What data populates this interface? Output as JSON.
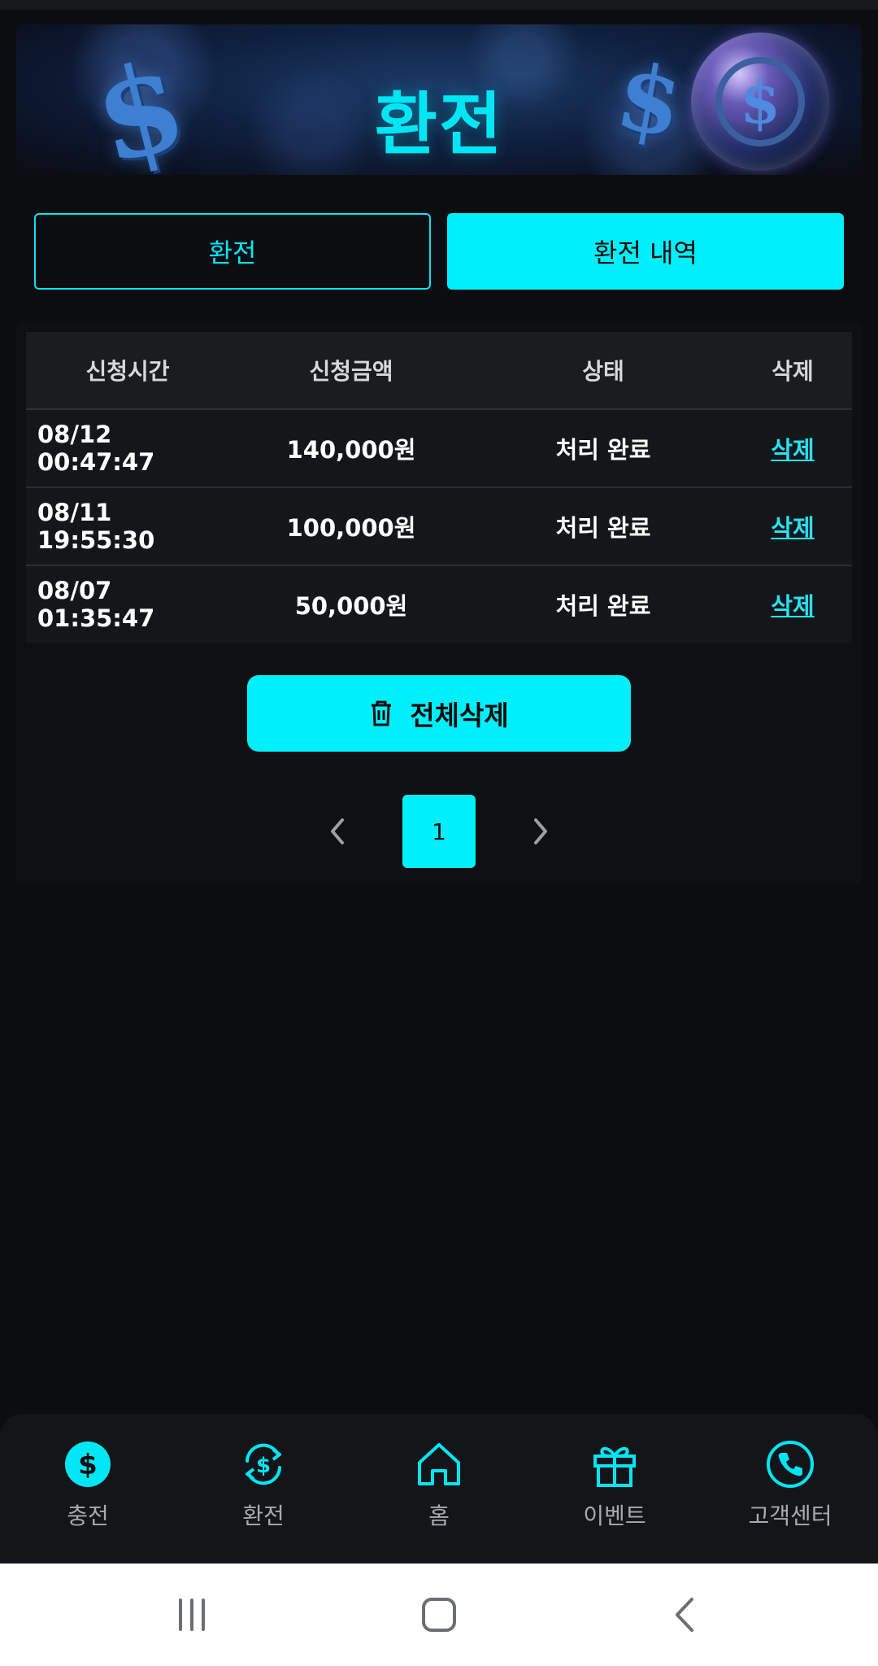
{
  "banner": {
    "title": "환전"
  },
  "tabs": {
    "exchange_label": "환전",
    "history_label": "환전 내역"
  },
  "table": {
    "headers": [
      "신청시간",
      "신청금액",
      "상태",
      "삭제"
    ],
    "rows": [
      {
        "time": "08/12 00:47:47",
        "amount": "140,000원",
        "status": "처리 완료",
        "action": "삭제"
      },
      {
        "time": "08/11 19:55:30",
        "amount": "100,000원",
        "status": "처리 완료",
        "action": "삭제"
      },
      {
        "time": "08/07 01:35:47",
        "amount": "50,000원",
        "status": "처리 완료",
        "action": "삭제"
      }
    ]
  },
  "delete_all": {
    "label": "전체삭제",
    "icon": "trash-icon"
  },
  "pagination": {
    "current_page": "1"
  },
  "bottom_nav": {
    "items": [
      {
        "label": "충전",
        "icon": "dollar-circle-icon"
      },
      {
        "label": "환전",
        "icon": "exchange-dollar-icon"
      },
      {
        "label": "홈",
        "icon": "home-icon"
      },
      {
        "label": "이벤트",
        "icon": "gift-icon"
      },
      {
        "label": "고객센터",
        "icon": "phone-icon"
      }
    ]
  },
  "colors": {
    "accent": "#00f0fb",
    "background": "#0b0d10",
    "text_muted": "#a7abb0"
  }
}
